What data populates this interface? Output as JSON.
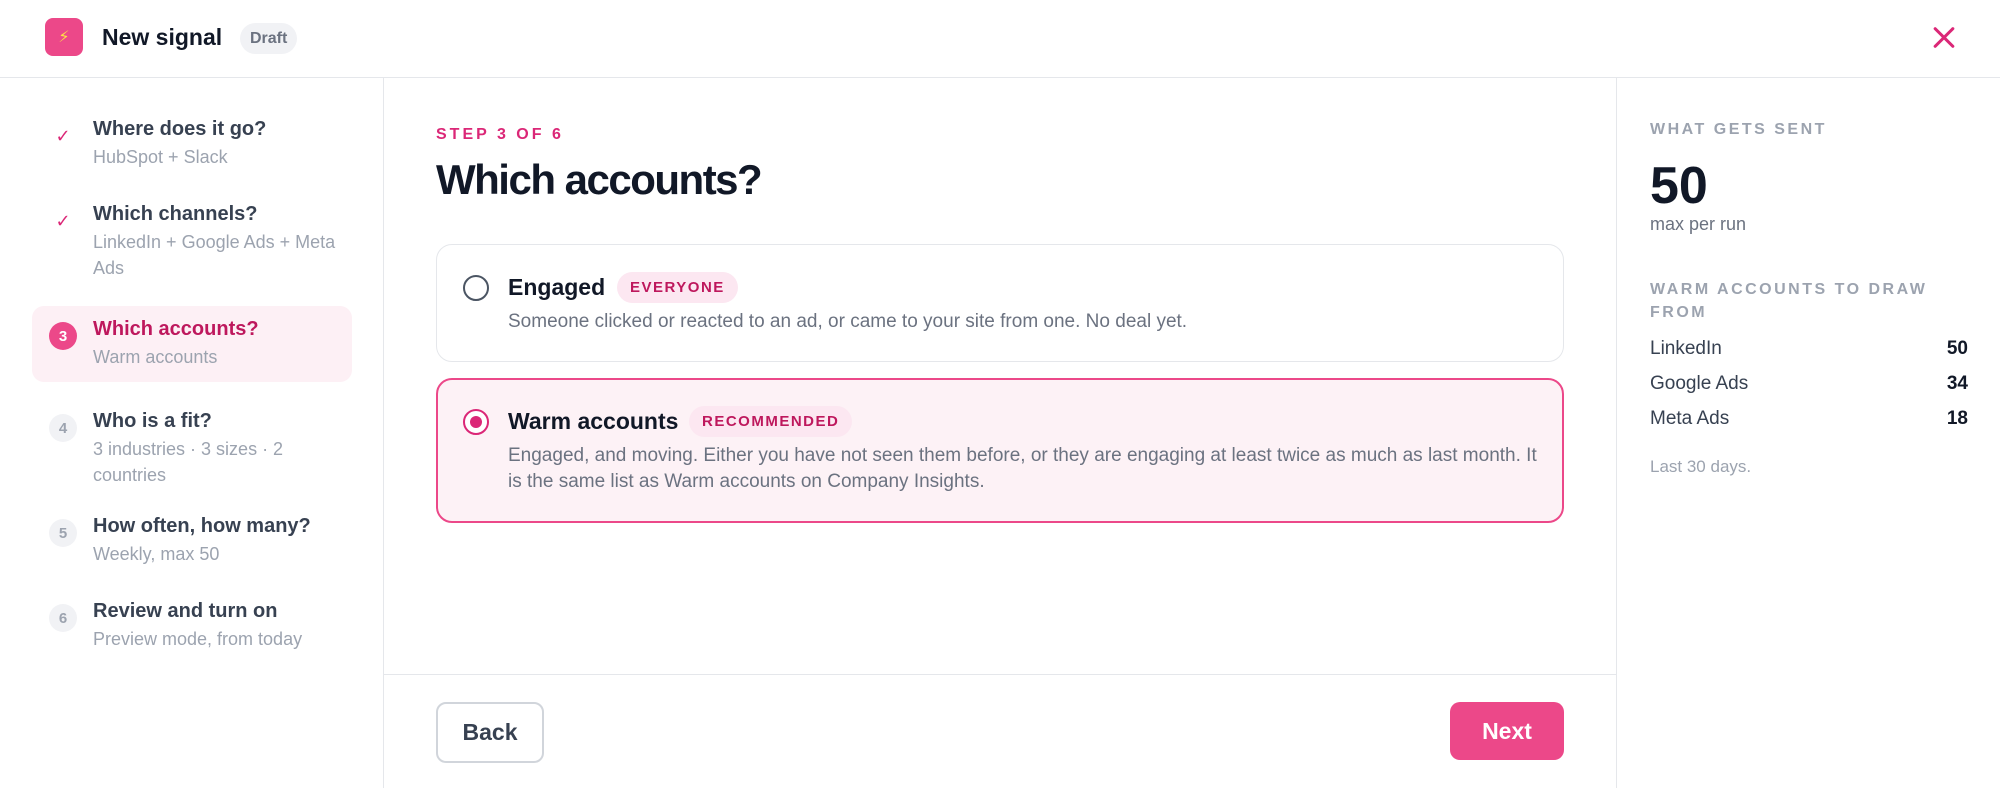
{
  "header": {
    "logo_icon": "lightning-bolt-icon",
    "title": "New signal",
    "status": "Draft",
    "close_icon": "close-x-icon"
  },
  "colors": {
    "accent": "#ec4889",
    "accent_dark": "#db2777",
    "active_bg": "#fdf0f5"
  },
  "steps": [
    {
      "marker": "✓",
      "state": "done",
      "title": "Where does it go?",
      "subtitle": "HubSpot + Slack"
    },
    {
      "marker": "✓",
      "state": "done",
      "title": "Which channels?",
      "subtitle": "LinkedIn + Google Ads + Meta Ads"
    },
    {
      "marker": "3",
      "state": "current",
      "title": "Which accounts?",
      "subtitle": "Warm accounts"
    },
    {
      "marker": "4",
      "state": "upcoming",
      "title": "Who is a fit?",
      "subtitle": "3 industries · 3 sizes · 2 countries"
    },
    {
      "marker": "5",
      "state": "upcoming",
      "title": "How often, how many?",
      "subtitle": "Weekly, max 50"
    },
    {
      "marker": "6",
      "state": "upcoming",
      "title": "Review and turn on",
      "subtitle": "Preview mode, from today"
    }
  ],
  "main": {
    "eyebrow": "STEP 3 OF 6",
    "heading": "Which accounts?",
    "options": [
      {
        "title": "Engaged",
        "badge": "EVERYONE",
        "description": "Someone clicked or reacted to an ad, or came to your site from one. No deal yet.",
        "selected": false
      },
      {
        "title": "Warm accounts",
        "badge": "RECOMMENDED",
        "description": "Engaged, and moving. Either you have not seen them before, or they are engaging at least twice as much as last month. It is the same list as Warm accounts on Company Insights.",
        "selected": true
      }
    ],
    "back_label": "Back",
    "next_label": "Next"
  },
  "summary": {
    "label": "WHAT GETS SENT",
    "value": "50",
    "value_caption": "max per run",
    "sources_label": "WARM ACCOUNTS TO DRAW FROM",
    "sources": [
      {
        "name": "LinkedIn",
        "count": "50"
      },
      {
        "name": "Google Ads",
        "count": "34"
      },
      {
        "name": "Meta Ads",
        "count": "18"
      }
    ],
    "note": "Last 30 days."
  }
}
